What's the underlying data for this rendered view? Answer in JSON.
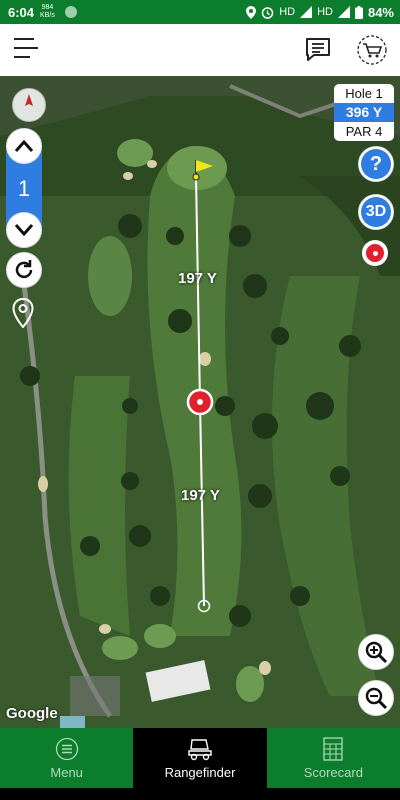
{
  "status_bar": {
    "time": "6:04",
    "speed_value": "984",
    "speed_unit": "KB/s",
    "network_1": "HD",
    "network_2": "HD",
    "battery": "84%"
  },
  "header": {
    "menu_icon": "hamburger-icon",
    "chat_icon": "chat-icon",
    "shop_icon": "cart-icon"
  },
  "map": {
    "distance_top": "197 Y",
    "distance_bottom": "197 Y",
    "hole_number": "1",
    "attribution": "Google"
  },
  "hole_info": {
    "hole_label": "Hole 1",
    "yards": "396 Y",
    "par": "PAR 4"
  },
  "side_buttons": {
    "help": "?",
    "view_3d": "3D"
  },
  "bottom_nav": {
    "tabs": [
      {
        "label": "Menu",
        "icon": "menu-icon"
      },
      {
        "label": "Rangefinder",
        "icon": "golf-cart-icon"
      },
      {
        "label": "Scorecard",
        "icon": "scorecard-icon"
      }
    ],
    "active_tab": "Rangefinder"
  },
  "colors": {
    "brand_green": "#0c7d2c",
    "accent_blue": "#2f7de1",
    "target_red": "#e0202c"
  }
}
